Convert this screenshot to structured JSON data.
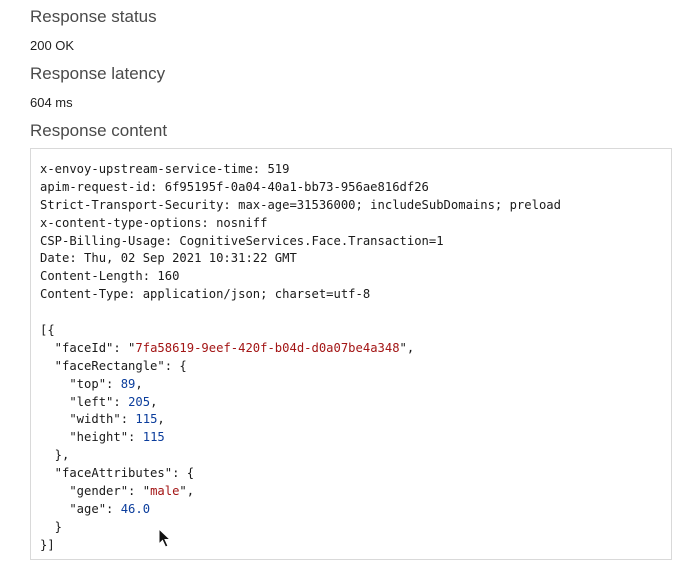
{
  "response_status": {
    "label": "Response status",
    "value": "200 OK"
  },
  "response_latency": {
    "label": "Response latency",
    "value": "604 ms"
  },
  "response_content": {
    "label": "Response content",
    "headers": [
      "x-envoy-upstream-service-time: 519",
      "apim-request-id: 6f95195f-0a04-40a1-bb73-956ae816df26",
      "Strict-Transport-Security: max-age=31536000; includeSubDomains; preload",
      "x-content-type-options: nosniff",
      "CSP-Billing-Usage: CognitiveServices.Face.Transaction=1",
      "Date: Thu, 02 Sep 2021 10:31:22 GMT",
      "Content-Length: 160",
      "Content-Type: application/json; charset=utf-8"
    ],
    "body": {
      "faceId": "7fa58619-9eef-420f-b04d-d0a07be4a348",
      "faceRectangle": {
        "top": "89",
        "left": "205",
        "width": "115",
        "height": "115"
      },
      "faceAttributes": {
        "gender": "male",
        "age": "46.0"
      }
    }
  },
  "colors": {
    "string": "#a31515",
    "number": "#0b3d9c",
    "border": "#d9d9d9"
  },
  "icons": {
    "cursor": "mouse-pointer-icon"
  }
}
